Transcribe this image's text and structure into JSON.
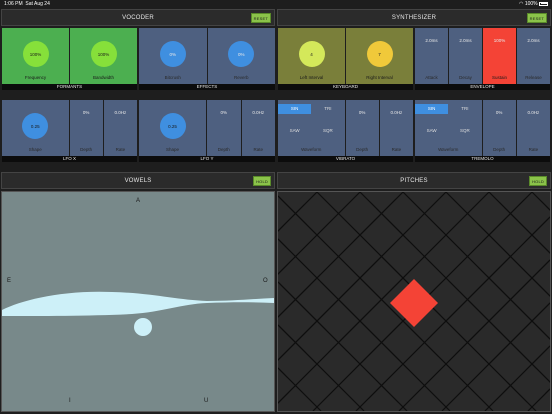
{
  "status": {
    "time": "1:06 PM",
    "date": "Sat Aug 24",
    "battery": "100%"
  },
  "vocoder": {
    "title": "VOCODER",
    "reset_label": "RESET",
    "formants": {
      "title": "FORMANTS",
      "frequency": {
        "value": "100%",
        "label": "Frequency"
      },
      "bandwidth": {
        "value": "100%",
        "label": "Bandwidth"
      }
    },
    "effects": {
      "title": "EFFECTS",
      "bitcrush": {
        "value": "0%",
        "label": "Bitcrush"
      },
      "reverb": {
        "value": "0%",
        "label": "Reverb"
      }
    },
    "lfo_x": {
      "title": "LFO X",
      "shape": {
        "value": "0.25",
        "label": "Shape"
      },
      "depth": {
        "value": "0%",
        "label": "Depth"
      },
      "rate": {
        "value": "0.0Hz",
        "label": "Rate"
      }
    },
    "lfo_y": {
      "title": "LFO Y",
      "shape": {
        "value": "0.25",
        "label": "Shape"
      },
      "depth": {
        "value": "0%",
        "label": "Depth"
      },
      "rate": {
        "value": "0.0Hz",
        "label": "Rate"
      }
    }
  },
  "synthesizer": {
    "title": "SYNTHESIZER",
    "keyboard": {
      "title": "KEYBOARD",
      "left": {
        "value": "4",
        "label": "Left Interval"
      },
      "right": {
        "value": "7",
        "label": "Right Interval"
      }
    },
    "envelope": {
      "title": "ENVELOPE",
      "attack": {
        "value": "2.0ms",
        "label": "Attack"
      },
      "decay": {
        "value": "2.0ms",
        "label": "Decay"
      },
      "sustain": {
        "value": "100%",
        "label": "Sustain"
      },
      "release": {
        "value": "2.0ms",
        "label": "Release"
      }
    },
    "vibrato": {
      "title": "VIBRATO",
      "waveform_label": "Waveform",
      "options": [
        "SIN",
        "TRI",
        "SAW",
        "SQR"
      ],
      "selected": "SIN",
      "depth": {
        "value": "0%",
        "label": "Depth"
      },
      "rate": {
        "value": "0.0Hz",
        "label": "Rate"
      }
    },
    "tremolo": {
      "title": "TREMOLO",
      "waveform_label": "Waveform",
      "options": [
        "SIN",
        "TRI",
        "SAW",
        "SQR"
      ],
      "selected": "SIN",
      "depth": {
        "value": "0%",
        "label": "Depth"
      },
      "rate": {
        "value": "0.0Hz",
        "label": "Rate"
      }
    }
  },
  "vowels": {
    "title": "VOWELS",
    "hold_label": "HOLD",
    "letters": {
      "a": "A",
      "e": "E",
      "o": "O",
      "i": "I",
      "u": "U"
    }
  },
  "pitches": {
    "title": "PITCHES",
    "hold_label": "HOLD"
  },
  "colors": {
    "green": "#4caf50",
    "blue": "#4e6080",
    "olive": "#7a7f3a",
    "red": "#f44336",
    "hold": "#8bc34a",
    "vowel_bg": "#78898a",
    "vowel_shape": "#cdf0f8",
    "active_pitch": "#f44336"
  }
}
